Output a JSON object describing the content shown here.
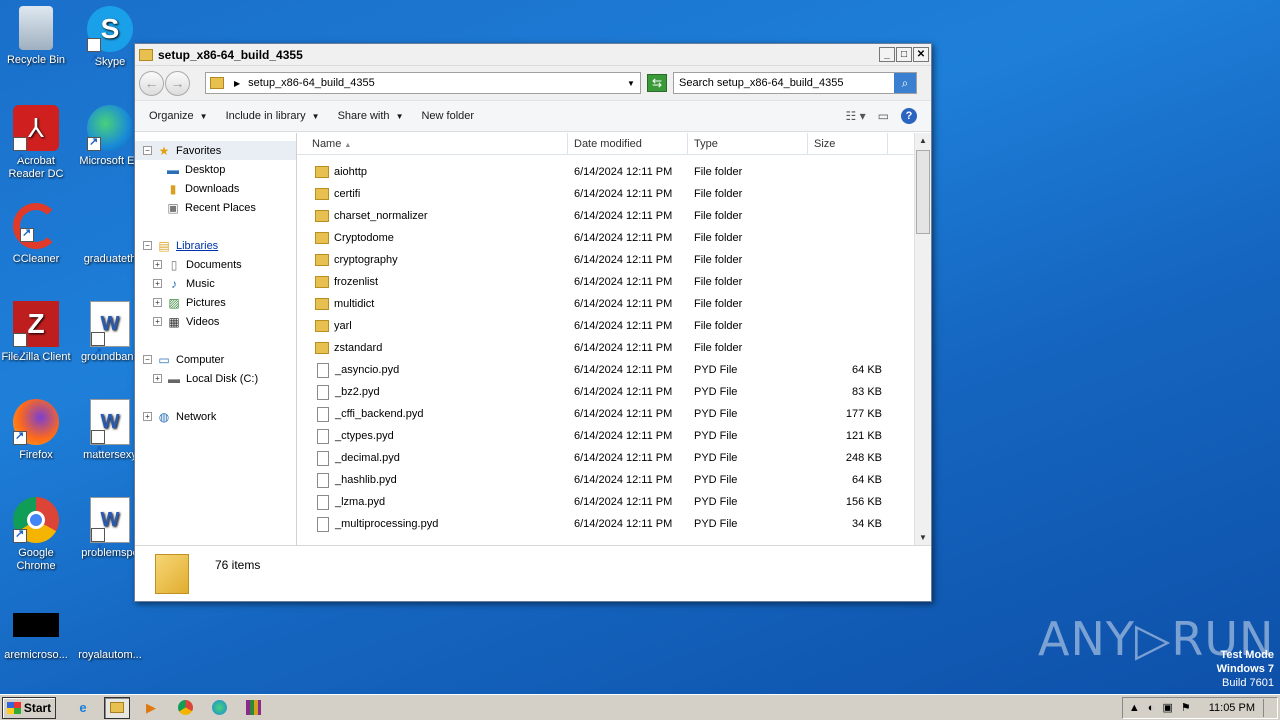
{
  "desktop": {
    "icons": [
      {
        "label": "Recycle Bin",
        "icon": "recycle-bin-icon"
      },
      {
        "label": "Skype",
        "icon": "skype-icon"
      },
      {
        "label": "Acrobat Reader DC",
        "icon": "acrobat-icon"
      },
      {
        "label": "Microsoft Ed",
        "icon": "edge-icon"
      },
      {
        "label": "CCleaner",
        "icon": "ccleaner-icon"
      },
      {
        "label": "graduateth",
        "icon": "blank-icon"
      },
      {
        "label": "FileZilla Client",
        "icon": "filezilla-icon"
      },
      {
        "label": "groundbanc",
        "icon": "word-doc-icon"
      },
      {
        "label": "Firefox",
        "icon": "firefox-icon"
      },
      {
        "label": "mattersexy",
        "icon": "word-doc-icon"
      },
      {
        "label": "Google Chrome",
        "icon": "chrome-icon"
      },
      {
        "label": "problemspe",
        "icon": "word-doc-icon"
      },
      {
        "label": "aremicroso...",
        "icon": "black-file-icon"
      },
      {
        "label": "royalautom...",
        "icon": "blank-icon"
      }
    ]
  },
  "window": {
    "title": "setup_x86-64_build_4355",
    "minimize": "_",
    "maximize": "□",
    "close": "✕",
    "address_path": "setup_x86-64_build_4355",
    "search_placeholder": "Search setup_x86-64_build_4355",
    "toolbar": {
      "organize": "Organize",
      "include": "Include in library",
      "share": "Share with",
      "new_folder": "New folder"
    },
    "nav": {
      "favorites": "Favorites",
      "desktop": "Desktop",
      "downloads": "Downloads",
      "recent": "Recent Places",
      "libraries": "Libraries",
      "documents": "Documents",
      "music": "Music",
      "pictures": "Pictures",
      "videos": "Videos",
      "computer": "Computer",
      "local_disk": "Local Disk (C:)",
      "network": "Network"
    },
    "columns": {
      "name": "Name",
      "date": "Date modified",
      "type": "Type",
      "size": "Size"
    },
    "files": [
      {
        "name": "aiohttp",
        "date": "6/14/2024 12:11 PM",
        "type": "File folder",
        "size": ""
      },
      {
        "name": "certifi",
        "date": "6/14/2024 12:11 PM",
        "type": "File folder",
        "size": ""
      },
      {
        "name": "charset_normalizer",
        "date": "6/14/2024 12:11 PM",
        "type": "File folder",
        "size": ""
      },
      {
        "name": "Cryptodome",
        "date": "6/14/2024 12:11 PM",
        "type": "File folder",
        "size": ""
      },
      {
        "name": "cryptography",
        "date": "6/14/2024 12:11 PM",
        "type": "File folder",
        "size": ""
      },
      {
        "name": "frozenlist",
        "date": "6/14/2024 12:11 PM",
        "type": "File folder",
        "size": ""
      },
      {
        "name": "multidict",
        "date": "6/14/2024 12:11 PM",
        "type": "File folder",
        "size": ""
      },
      {
        "name": "yarl",
        "date": "6/14/2024 12:11 PM",
        "type": "File folder",
        "size": ""
      },
      {
        "name": "zstandard",
        "date": "6/14/2024 12:11 PM",
        "type": "File folder",
        "size": ""
      },
      {
        "name": "_asyncio.pyd",
        "date": "6/14/2024 12:11 PM",
        "type": "PYD File",
        "size": "64 KB"
      },
      {
        "name": "_bz2.pyd",
        "date": "6/14/2024 12:11 PM",
        "type": "PYD File",
        "size": "83 KB"
      },
      {
        "name": "_cffi_backend.pyd",
        "date": "6/14/2024 12:11 PM",
        "type": "PYD File",
        "size": "177 KB"
      },
      {
        "name": "_ctypes.pyd",
        "date": "6/14/2024 12:11 PM",
        "type": "PYD File",
        "size": "121 KB"
      },
      {
        "name": "_decimal.pyd",
        "date": "6/14/2024 12:11 PM",
        "type": "PYD File",
        "size": "248 KB"
      },
      {
        "name": "_hashlib.pyd",
        "date": "6/14/2024 12:11 PM",
        "type": "PYD File",
        "size": "64 KB"
      },
      {
        "name": "_lzma.pyd",
        "date": "6/14/2024 12:11 PM",
        "type": "PYD File",
        "size": "156 KB"
      },
      {
        "name": "_multiprocessing.pyd",
        "date": "6/14/2024 12:11 PM",
        "type": "PYD File",
        "size": "34 KB"
      }
    ],
    "item_count": "76 items"
  },
  "taskbar": {
    "start": "Start",
    "clock": "11:05 PM"
  },
  "watermark": {
    "line1": "Test Mode",
    "line2": "Windows 7",
    "line3": "Build 7601",
    "brand": "ANY▷RUN"
  }
}
